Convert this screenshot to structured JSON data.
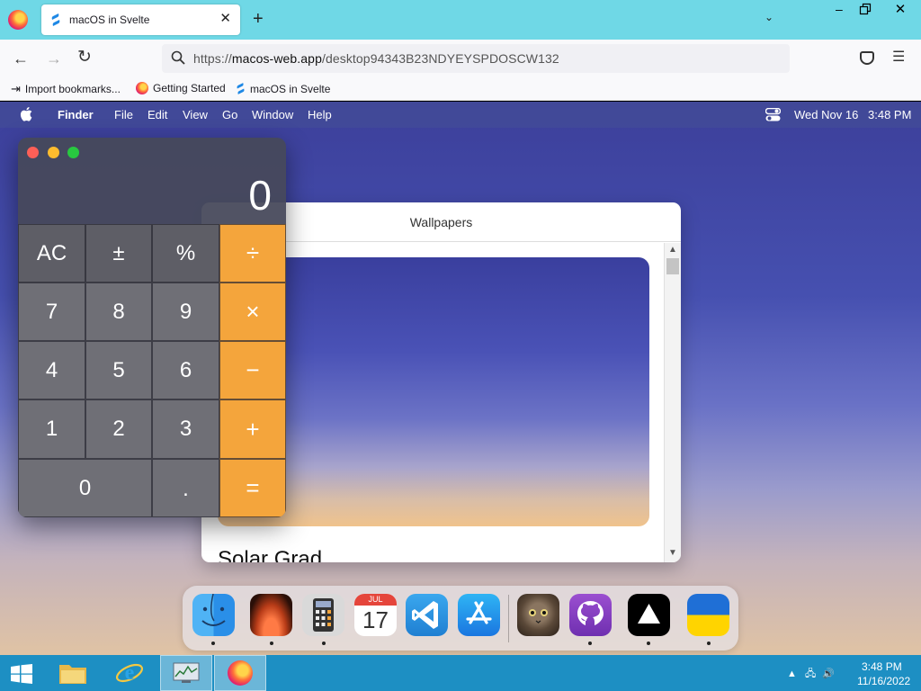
{
  "browser": {
    "tab_title": "macOS in Svelte",
    "url_prefix": "https://",
    "url_host": "macos-web.app",
    "url_path": "/desktop94343B23NDYEYSPDOSCW132",
    "bookmarks": [
      {
        "label": "Import bookmarks...",
        "icon": "import-icon"
      },
      {
        "label": "Getting Started",
        "icon": "firefox-icon"
      },
      {
        "label": "macOS in Svelte",
        "icon": "svelte-favicon-icon"
      }
    ]
  },
  "menubar": {
    "app_name": "Finder",
    "menus": [
      "File",
      "Edit",
      "View",
      "Go",
      "Window",
      "Help"
    ],
    "date": "Wed Nov 16",
    "time": "3:48 PM"
  },
  "wallpapers": {
    "title": "Wallpapers",
    "current_name": "Solar Grad"
  },
  "calculator": {
    "display": "0",
    "keys": {
      "ac": "AC",
      "sign": "±",
      "percent": "%",
      "divide": "÷",
      "seven": "7",
      "eight": "8",
      "nine": "9",
      "multiply": "×",
      "four": "4",
      "five": "5",
      "six": "6",
      "minus": "−",
      "one": "1",
      "two": "2",
      "three": "3",
      "plus": "+",
      "zero": "0",
      "decimal": ".",
      "equals": "="
    }
  },
  "dock": {
    "apps": [
      "Finder",
      "Wallpapers",
      "Calculator",
      "Calendar",
      "VS Code",
      "App Store",
      "Purus Twitter",
      "GitHub",
      "Vercel",
      "Ukraine"
    ],
    "calendar_month": "JUL",
    "calendar_day": "17"
  },
  "taskbar": {
    "time": "3:48 PM",
    "date": "11/16/2022"
  },
  "colors": {
    "calc_operator": "#f4a53c",
    "tabstrip": "#6fd8e6",
    "taskbar": "#1d8fc3"
  }
}
